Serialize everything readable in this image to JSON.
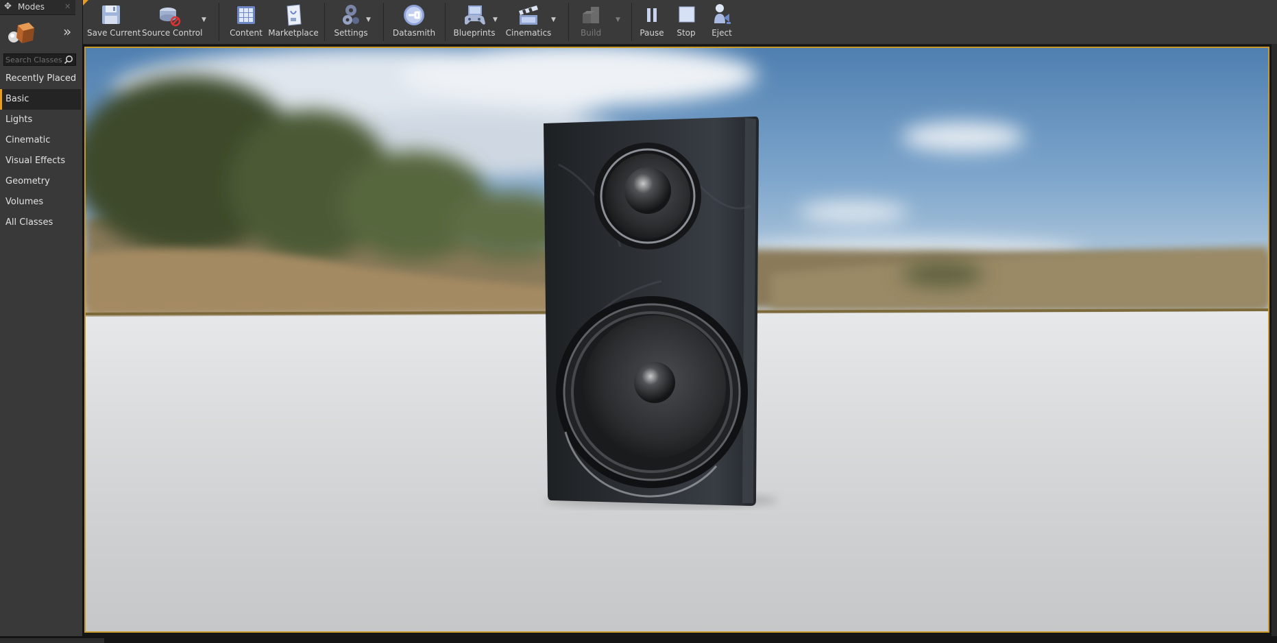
{
  "modes_panel": {
    "tab_title": "Modes",
    "search_placeholder": "Search Classes",
    "categories": [
      {
        "label": "Recently Placed"
      },
      {
        "label": "Basic",
        "selected": true
      },
      {
        "label": "Lights"
      },
      {
        "label": "Cinematic"
      },
      {
        "label": "Visual Effects"
      },
      {
        "label": "Geometry"
      },
      {
        "label": "Volumes"
      },
      {
        "label": "All Classes"
      }
    ]
  },
  "toolbar": {
    "buttons": [
      {
        "label": "Save Current",
        "icon": "floppy-disk-icon"
      },
      {
        "label": "Source Control",
        "icon": "source-control-icon",
        "dropdown": true
      },
      {
        "label": "Content",
        "icon": "content-browser-icon"
      },
      {
        "label": "Marketplace",
        "icon": "marketplace-icon"
      },
      {
        "label": "Settings",
        "icon": "gears-icon",
        "dropdown": true
      },
      {
        "label": "Datasmith",
        "icon": "datasmith-icon"
      },
      {
        "label": "Blueprints",
        "icon": "gamepad-icon",
        "dropdown": true
      },
      {
        "label": "Cinematics",
        "icon": "clapperboard-icon",
        "dropdown": true
      },
      {
        "label": "Build",
        "icon": "build-blocks-icon",
        "dropdown": true,
        "disabled": true
      },
      {
        "label": "Pause",
        "icon": "pause-icon"
      },
      {
        "label": "Stop",
        "icon": "stop-icon"
      },
      {
        "label": "Eject",
        "icon": "eject-icon"
      }
    ]
  },
  "colors": {
    "accent": "#e89d1d",
    "panel_bg": "#393939",
    "toolbar_bg": "#3a3a3a",
    "viewport_border": "#c99a2a"
  },
  "viewport": {
    "content": "3D scene of a black wooden loudspeaker with a tweeter and woofer on a white floor in front of a blurred landscape sky"
  }
}
